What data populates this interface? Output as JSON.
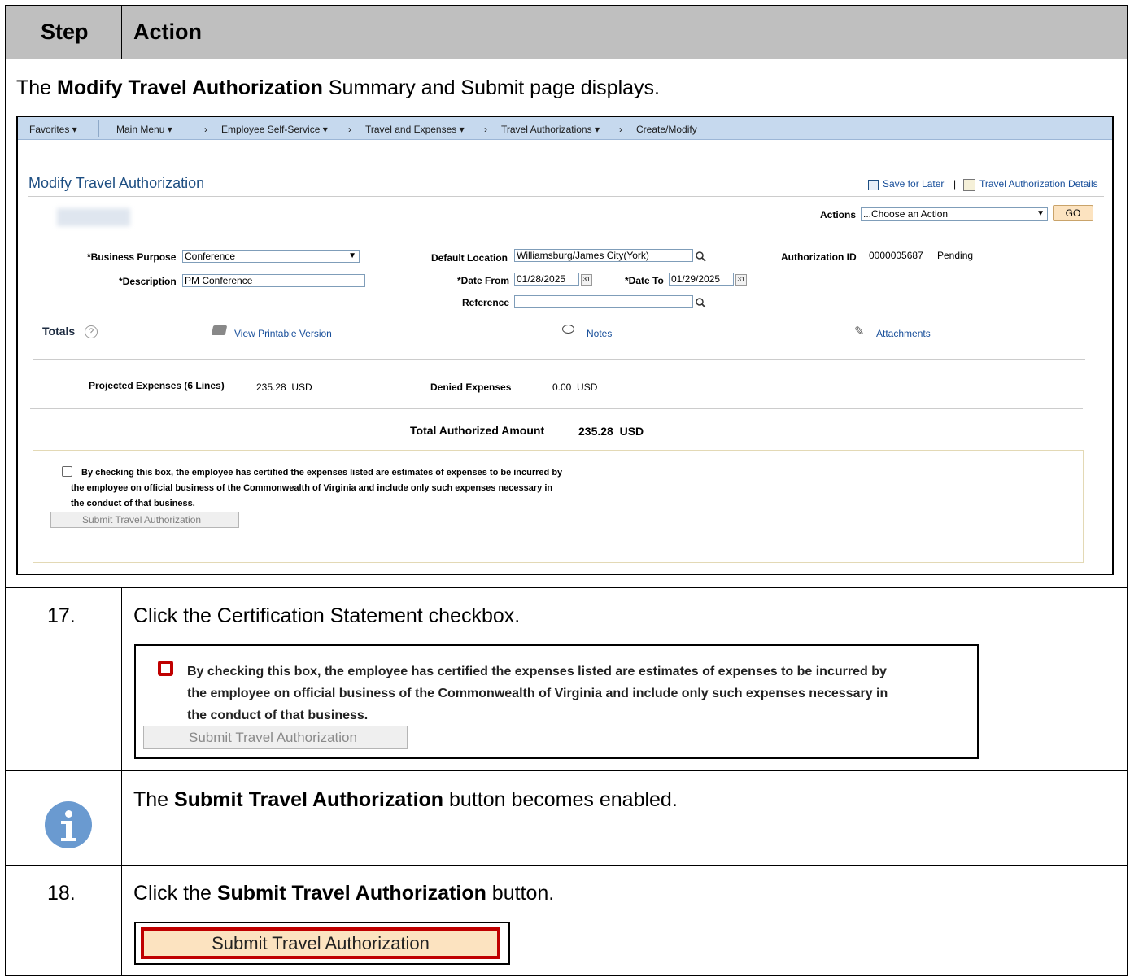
{
  "table": {
    "step_header": "Step",
    "action_header": "Action",
    "intro": {
      "prefix": "The ",
      "bold": "Modify Travel Authorization",
      "suffix": " Summary and Submit page displays."
    },
    "step17": {
      "number": "17.",
      "text": "Click the Certification Statement checkbox."
    },
    "info": {
      "prefix": "The ",
      "bold": "Submit Travel Authorization",
      "suffix": " button becomes enabled."
    },
    "step18": {
      "number": "18.",
      "prefix": "Click the ",
      "bold": "Submit Travel Authorization",
      "suffix": " button."
    }
  },
  "screenshot": {
    "nav": {
      "favorites": "Favorites ▾",
      "main_menu": "Main Menu ▾",
      "sep": "›",
      "ess": "Employee Self-Service ▾",
      "tne": "Travel and Expenses ▾",
      "ta": "Travel Authorizations ▾",
      "create": "Create/Modify"
    },
    "page_title": "Modify Travel Authorization",
    "save_for_later": "Save for Later",
    "link_sep": "|",
    "ta_details": "Travel Authorization Details",
    "actions_label": "Actions",
    "actions_value": "...Choose an Action",
    "go": "GO",
    "business_purpose_label": "*Business Purpose",
    "business_purpose_value": "Conference",
    "description_label": "*Description",
    "description_value": "PM Conference",
    "default_location_label": "Default Location",
    "default_location_value": "Williamsburg/James City(York)",
    "date_from_label": "*Date From",
    "date_from_value": "01/28/2025",
    "date_to_label": "*Date To",
    "date_to_value": "01/29/2025",
    "reference_label": "Reference",
    "reference_value": "",
    "auth_id_label": "Authorization ID",
    "auth_id_value": "0000005687",
    "auth_status": "Pending",
    "totals": "Totals",
    "view_printable": "View Printable Version",
    "notes": "Notes",
    "attachments": "Attachments",
    "projected_label": "Projected Expenses (6 Lines)",
    "projected_value": "235.28  USD",
    "denied_label": "Denied Expenses",
    "denied_value": "0.00  USD",
    "total_label": "Total Authorized Amount",
    "total_value": "235.28  USD",
    "cert_line1": "By checking this box, the employee has certified the expenses listed are estimates of expenses to be incurred by",
    "cert_line2": "the employee on official business of the Commonwealth of Virginia and include only such expenses necessary in",
    "cert_line3": "the conduct of that business.",
    "submit_button": "Submit Travel Authorization"
  },
  "zoom17": {
    "cert_line1": "By checking this box, the employee has certified the expenses listed are estimates of expenses to be incurred by",
    "cert_line2": "the employee on official business of the Commonwealth of Virginia and include only such expenses necessary in",
    "cert_line3": "the conduct of that business.",
    "submit_button": "Submit Travel Authorization"
  },
  "zoom18": {
    "submit_button": "Submit Travel Authorization"
  },
  "colors": {
    "header_bg": "#bfbfbf",
    "highlight_red": "#c00000",
    "info_icon": "#6a9ad0",
    "submit_bg": "#fce3c0"
  }
}
